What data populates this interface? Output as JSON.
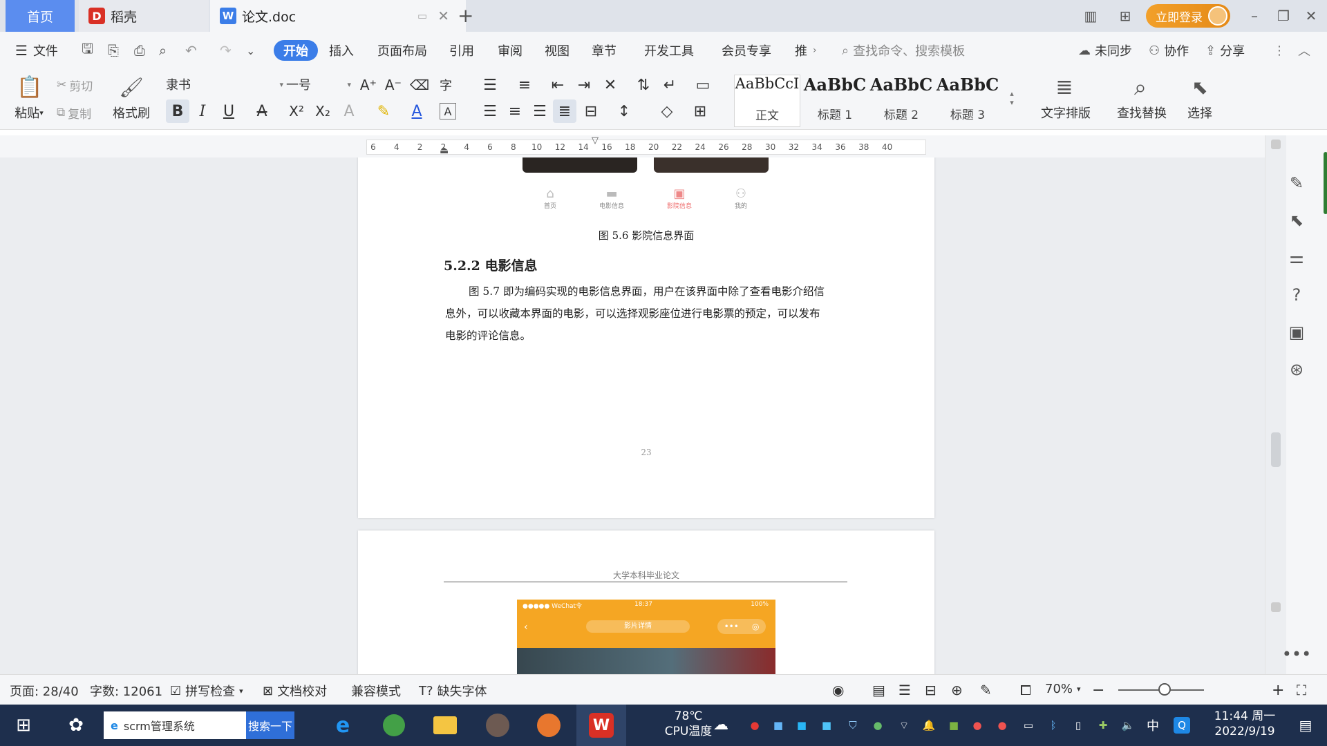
{
  "titlebar": {
    "tabs": [
      {
        "label": "首页"
      },
      {
        "label": "稻壳"
      },
      {
        "label": "论文.doc"
      }
    ],
    "login_label": "立即登录"
  },
  "menu": {
    "file": "文件",
    "items": [
      "开始",
      "插入",
      "页面布局",
      "引用",
      "审阅",
      "视图",
      "章节",
      "开发工具",
      "会员专享",
      "推"
    ],
    "search_placeholder": "查找命令、搜索模板",
    "unsync": "未同步",
    "collab": "协作",
    "share": "分享"
  },
  "ribbon": {
    "paste": "粘贴",
    "cut": "剪切",
    "copy": "复制",
    "format_painter": "格式刷",
    "font_name": "隶书",
    "font_size": "一号",
    "styles": [
      {
        "sample": "AaBbCcI",
        "label": "正文"
      },
      {
        "sample": "AaBbC",
        "label": "标题 1"
      },
      {
        "sample": "AaBbC",
        "label": "标题 2"
      },
      {
        "sample": "AaBbC",
        "label": "标题 3"
      }
    ],
    "text_layout": "文字排版",
    "find_replace": "查找替换",
    "select": "选择"
  },
  "ruler": {
    "ticks": [
      "6",
      "4",
      "2",
      "2",
      "4",
      "6",
      "8",
      "10",
      "12",
      "14",
      "16",
      "18",
      "20",
      "22",
      "24",
      "26",
      "28",
      "30",
      "32",
      "34",
      "36",
      "38",
      "40"
    ]
  },
  "document": {
    "nav_labels": [
      "首页",
      "电影信息",
      "影院信息",
      "我的"
    ],
    "figure_caption": "图 5.6  影院信息界面",
    "section_heading": "5.2.2  电影信息",
    "paragraph_lines": [
      "图 5.7 即为编码实现的电影信息界面，用户在该界面中除了查看电影介绍信",
      "息外，可以收藏本界面的电影，可以选择观影座位进行电影票的预定，可以发布",
      "电影的评论信息。"
    ],
    "page_number": "23",
    "page2_header": "大学本科毕业论文",
    "phone_status": "●●●●● WeChat令",
    "phone_time": "18:37",
    "phone_battery": "100%",
    "phone_title": "影片详情"
  },
  "statusbar": {
    "page": "页面: 28/40",
    "words": "字数: 12061",
    "spell": "拼写检查",
    "proof": "文档校对",
    "compat": "兼容模式",
    "missing_font": "缺失字体",
    "zoom": "70%"
  },
  "taskbar": {
    "search_text": "scrm管理系统",
    "search_button": "搜索一下",
    "temp": "78℃",
    "temp_label": "CPU温度",
    "ime": "中",
    "time": "11:44 周一",
    "date": "2022/9/19"
  },
  "colors": {
    "accent": "#3b7de8",
    "login": "#f2a02a",
    "phone_orange": "#f5a623",
    "taskbar": "#1e2f4d"
  }
}
